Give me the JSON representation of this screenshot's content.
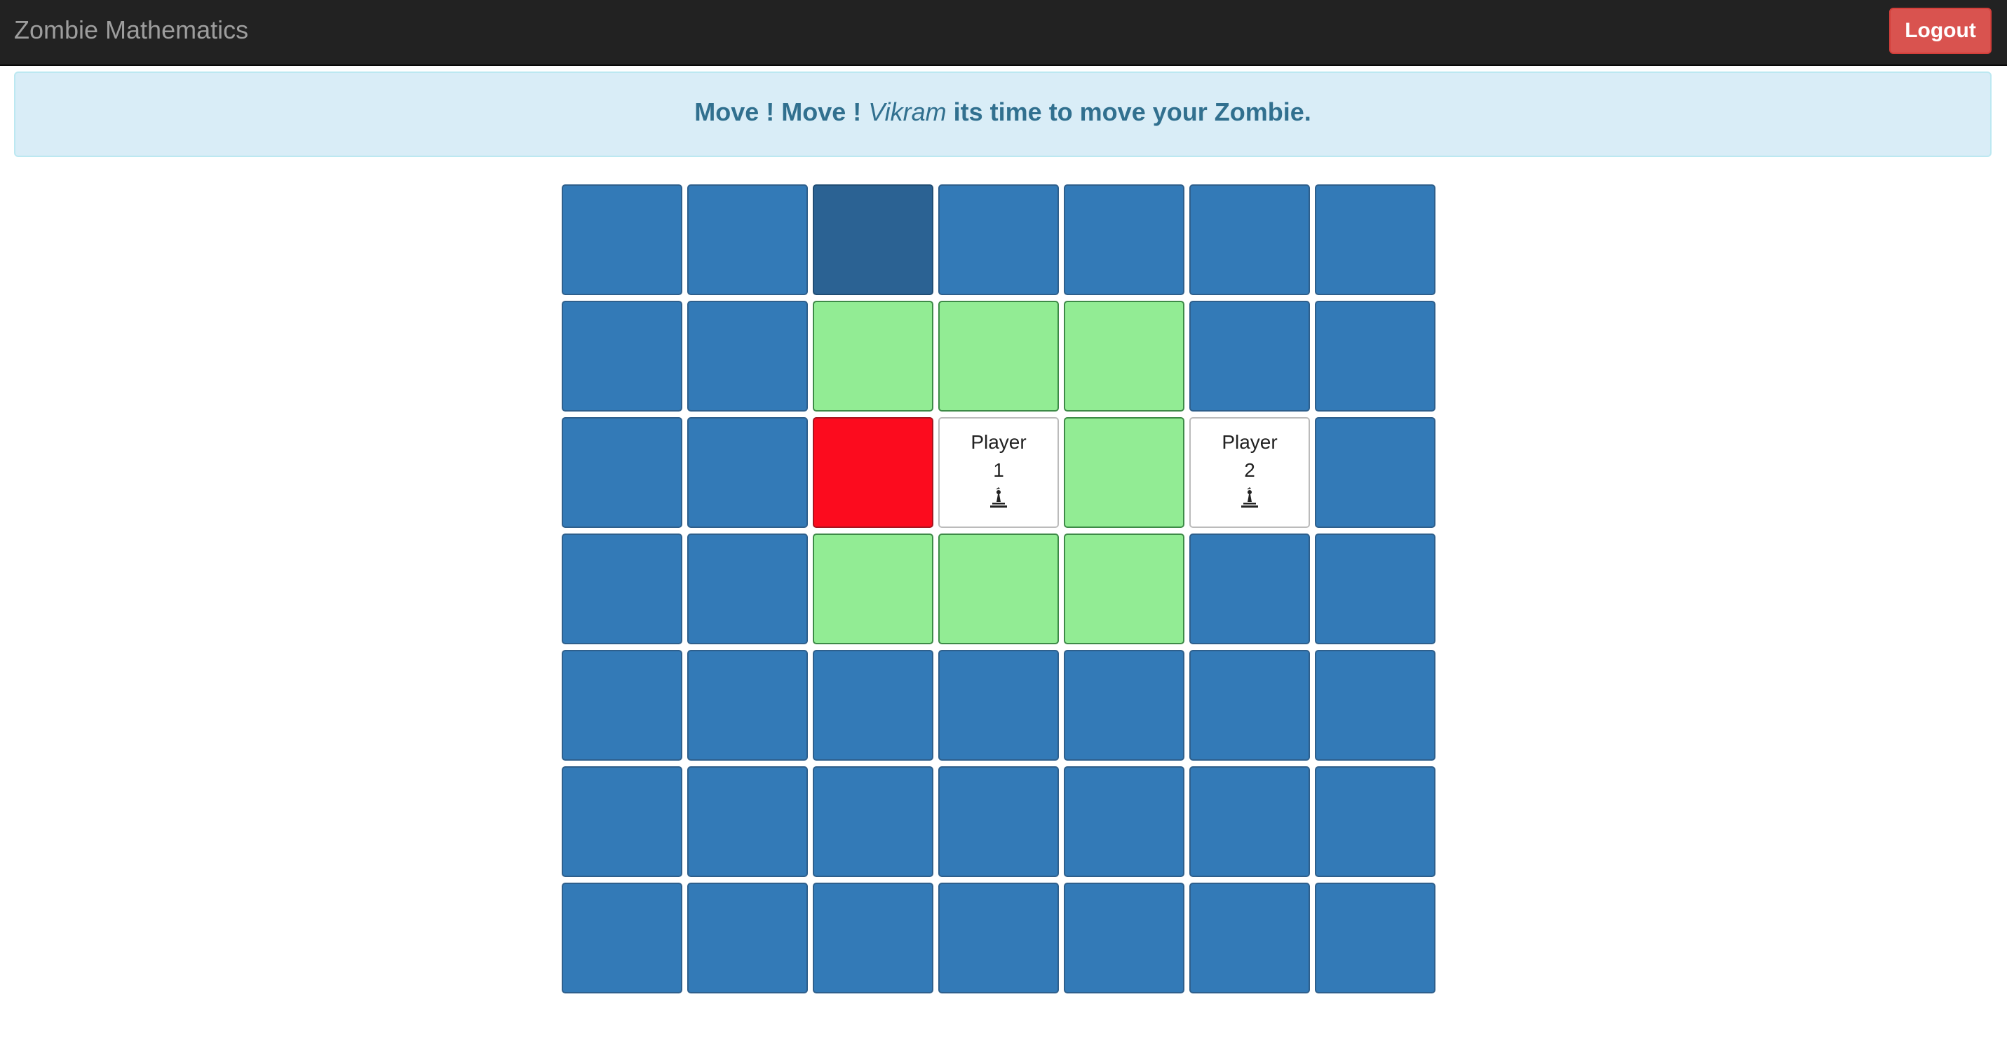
{
  "app": {
    "title": "Zombie Mathematics",
    "logout_label": "Logout"
  },
  "alert": {
    "prefix": "Move ! Move !",
    "player_name": "Vikram",
    "suffix": "its time to move your Zombie."
  },
  "board": {
    "rows": 7,
    "cols": 7,
    "players": [
      {
        "label": "Player",
        "number": "1",
        "row": 2,
        "col": 3,
        "icon": "pawn-icon"
      },
      {
        "label": "Player",
        "number": "2",
        "row": 2,
        "col": 5,
        "icon": "pawn-icon"
      }
    ],
    "zombie": {
      "row": 2,
      "col": 2
    },
    "selected": [
      {
        "row": 0,
        "col": 2
      }
    ],
    "valid_moves": [
      {
        "row": 1,
        "col": 2
      },
      {
        "row": 1,
        "col": 3
      },
      {
        "row": 1,
        "col": 4
      },
      {
        "row": 2,
        "col": 4
      },
      {
        "row": 3,
        "col": 2
      },
      {
        "row": 3,
        "col": 3
      },
      {
        "row": 3,
        "col": 4
      }
    ]
  },
  "colors": {
    "navbar": "#222222",
    "brand_text": "#9d9d9d",
    "logout": "#d9534f",
    "alert_bg": "#d9edf7",
    "alert_text": "#31708f",
    "tile": "#337ab7",
    "tile_selected": "#2b6293",
    "valid_move": "#92ec94",
    "zombie": "#fc0b1e",
    "player_tile": "#ffffff"
  }
}
